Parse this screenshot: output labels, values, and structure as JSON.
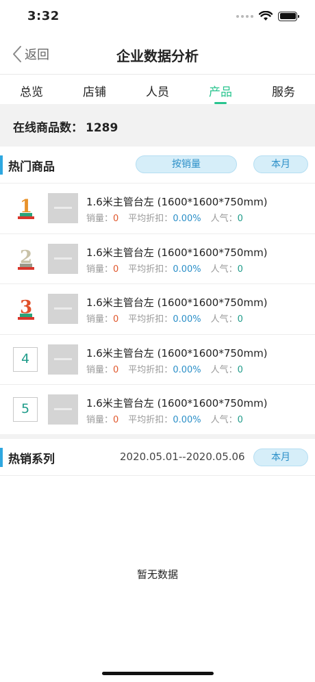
{
  "status_bar": {
    "time": "3:32"
  },
  "nav": {
    "back_label": "返回",
    "title": "企业数据分析"
  },
  "tabs": [
    {
      "label": "总览",
      "active": false
    },
    {
      "label": "店铺",
      "active": false
    },
    {
      "label": "人员",
      "active": false
    },
    {
      "label": "产品",
      "active": true
    },
    {
      "label": "服务",
      "active": false
    }
  ],
  "online": {
    "label": "在线商品数：",
    "count": "1289"
  },
  "hot_products": {
    "title": "热门商品",
    "sort_label": "按销量",
    "period_label": "本月",
    "meta_labels": {
      "sales": "销量：",
      "discount": "平均折扣：",
      "popularity": "人气："
    },
    "items": [
      {
        "rank": "1",
        "name": "1.6米主管台左 (1600*1600*750mm)",
        "sales": "0",
        "discount": "0.00%",
        "popularity": "0"
      },
      {
        "rank": "2",
        "name": "1.6米主管台左 (1600*1600*750mm)",
        "sales": "0",
        "discount": "0.00%",
        "popularity": "0"
      },
      {
        "rank": "3",
        "name": "1.6米主管台左 (1600*1600*750mm)",
        "sales": "0",
        "discount": "0.00%",
        "popularity": "0"
      },
      {
        "rank": "4",
        "name": "1.6米主管台左 (1600*1600*750mm)",
        "sales": "0",
        "discount": "0.00%",
        "popularity": "0"
      },
      {
        "rank": "5",
        "name": "1.6米主管台左 (1600*1600*750mm)",
        "sales": "0",
        "discount": "0.00%",
        "popularity": "0"
      }
    ]
  },
  "hot_series": {
    "title": "热销系列",
    "date_range": "2020.05.01--2020.05.06",
    "period_label": "本月",
    "empty_text": "暂无数据"
  },
  "colors": {
    "accent_green": "#28c48e",
    "accent_blue": "#2ea7e0",
    "value_red": "#e0572c",
    "value_teal": "#1f9c8a"
  }
}
